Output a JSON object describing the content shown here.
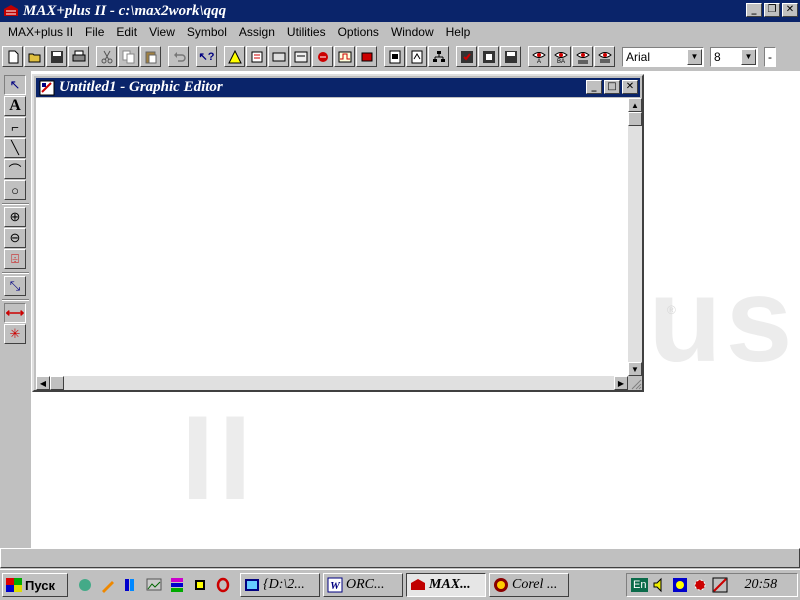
{
  "app": {
    "title": "MAX+plus II - c:\\max2work\\qqq",
    "icon": "max-logo-icon",
    "window_buttons": [
      "_",
      "❐",
      "✕"
    ]
  },
  "menu": [
    "MAX+plus II",
    "File",
    "Edit",
    "View",
    "Symbol",
    "Assign",
    "Utilities",
    "Options",
    "Window",
    "Help"
  ],
  "toolbar": {
    "font_value": "Arial",
    "size_value": "8",
    "third_value": "-"
  },
  "child_window": {
    "title": "Untitled1 - Graphic Editor",
    "window_buttons": [
      "_",
      "□",
      "✕"
    ]
  },
  "workspace": {
    "watermark": "MAX+plus II",
    "reg_mark": "®"
  },
  "palette": [
    "↖",
    "A",
    "⌐",
    "╲",
    "⌒",
    "○",
    "⊕",
    "⊖",
    "⌹",
    "⤡",
    "⟷",
    "✳"
  ],
  "taskbar": {
    "start_label": "Пуск",
    "tasks": [
      {
        "label": "{D:\\2...",
        "active": false,
        "icon": "folder-icon"
      },
      {
        "label": "ORC...",
        "active": false,
        "icon": "word-icon"
      },
      {
        "label": "MAX...",
        "active": true,
        "icon": "max-logo-icon"
      },
      {
        "label": "Corel ...",
        "active": false,
        "icon": "corel-icon"
      }
    ],
    "language": "En",
    "clock": "20:58"
  },
  "colors": {
    "titlebar": "#0a246a",
    "face": "#c0c0c0",
    "workspace": "#ffffff"
  }
}
